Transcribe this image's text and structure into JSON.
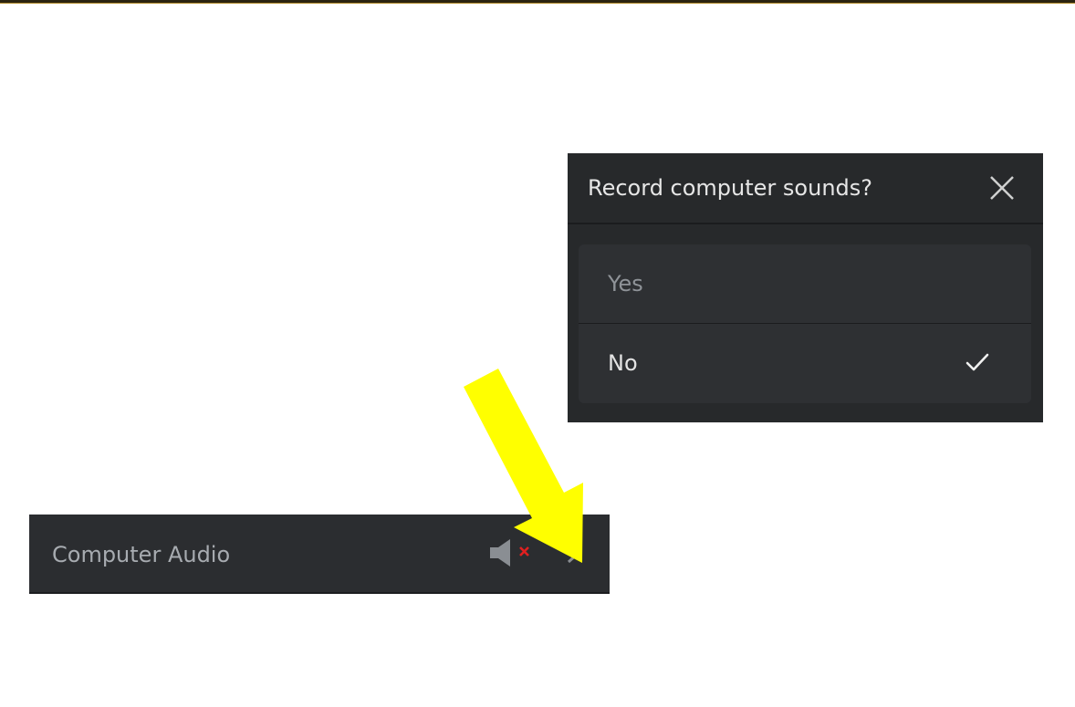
{
  "dialog": {
    "title": "Record computer sounds?",
    "close_icon": "close-icon",
    "options": [
      {
        "label": "Yes",
        "selected": false
      },
      {
        "label": "No",
        "selected": true
      }
    ],
    "selected_icon": "check-icon"
  },
  "audio_bar": {
    "label": "Computer Audio",
    "mute_icon": "speaker-muted-icon",
    "expand_icon": "chevron-right-icon"
  },
  "annotation": {
    "arrow_color": "#ffff00",
    "arrow_icon": "arrow-icon"
  },
  "colors": {
    "panel_bg": "#27292b",
    "option_bg": "#2e3033",
    "accent_red": "#e02020"
  }
}
